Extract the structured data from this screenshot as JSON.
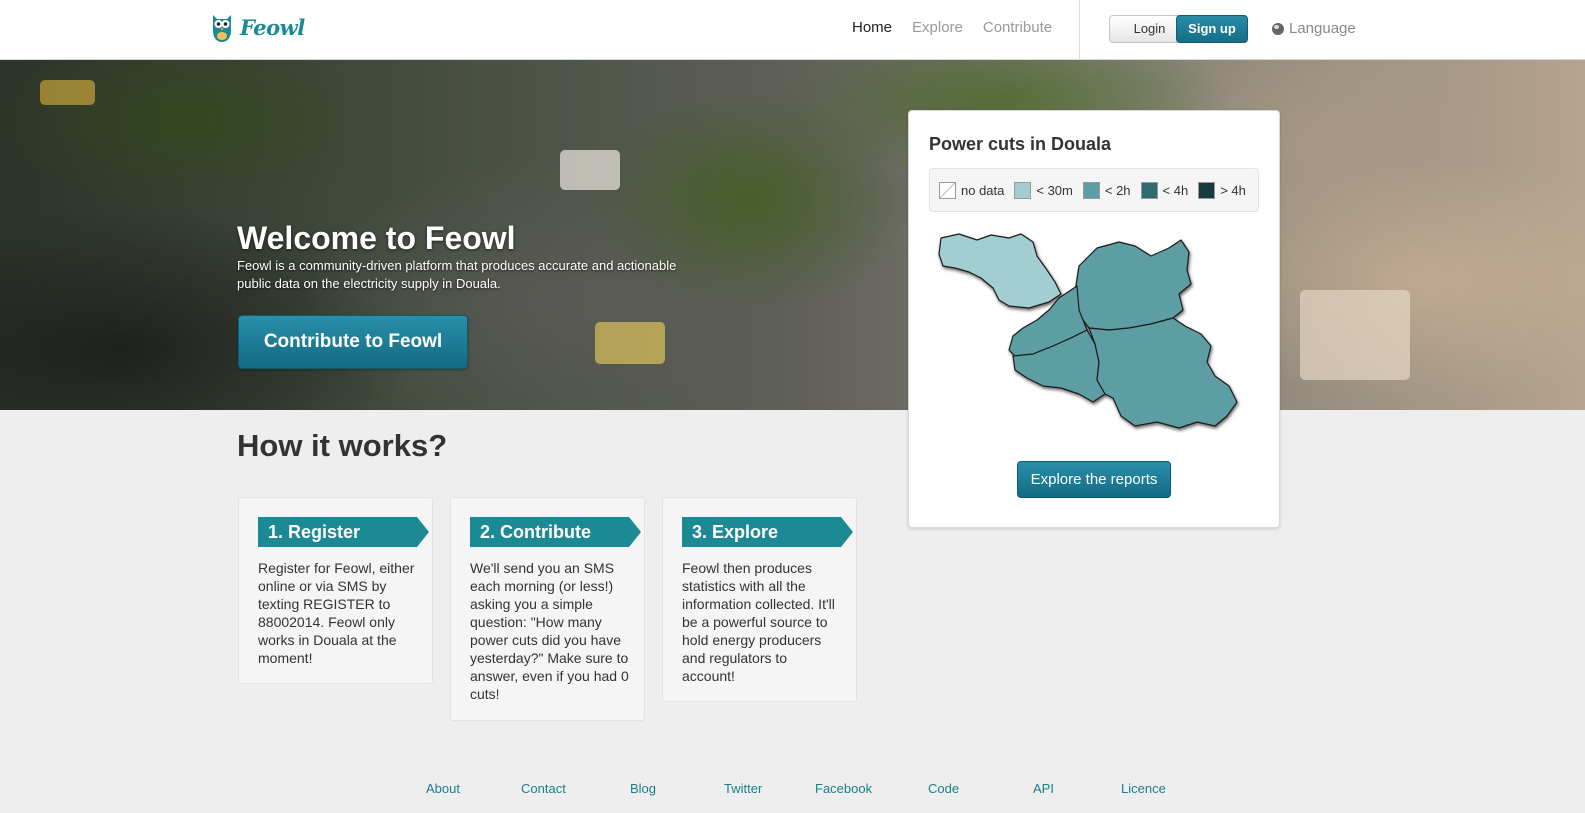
{
  "brand": {
    "name": "Feowl"
  },
  "nav": {
    "items": [
      "Home",
      "Explore",
      "Contribute"
    ],
    "active": "Home"
  },
  "auth": {
    "login_label": "Login",
    "signup_label": "Sign up"
  },
  "language": {
    "label": "Language",
    "icon": "globe-icon"
  },
  "hero": {
    "title": "Welcome to Feowl",
    "text": "Feowl is a community-driven platform that produces accurate and actionable public data on the electricity supply in Douala.",
    "cta_label": "Contribute to Feowl"
  },
  "map": {
    "title": "Power cuts in Douala",
    "legend": [
      {
        "label": "no data",
        "color": "#ffffff"
      },
      {
        "label": "< 30m",
        "color": "#a2cdd1"
      },
      {
        "label": "< 2h",
        "color": "#5b9ea3"
      },
      {
        "label": "< 4h",
        "color": "#2f6b71"
      },
      {
        "label": "> 4h",
        "color": "#163a3e"
      }
    ],
    "button_label": "Explore the reports"
  },
  "how": {
    "title": "How it works?",
    "steps": [
      {
        "title": "1. Register",
        "text": "Register for Feowl, either online or via SMS by texting REGISTER to 88002014. Feowl only works in Douala at the moment!"
      },
      {
        "title": "2. Contribute",
        "text": "We'll send you an SMS each morning (or less!) asking you a simple question: \"How many power cuts did you have yesterday?\" Make sure to answer, even if you had 0 cuts!"
      },
      {
        "title": "3. Explore",
        "text": "Feowl then produces statistics with all the information collected. It'll be a powerful source to hold energy producers and regulators to account!"
      }
    ]
  },
  "footer": {
    "links": [
      "About",
      "Contact",
      "Blog",
      "Twitter",
      "Facebook",
      "Code",
      "API",
      "Licence"
    ]
  },
  "colors": {
    "brand": "#1b8a94",
    "button": "#1d7a94"
  }
}
